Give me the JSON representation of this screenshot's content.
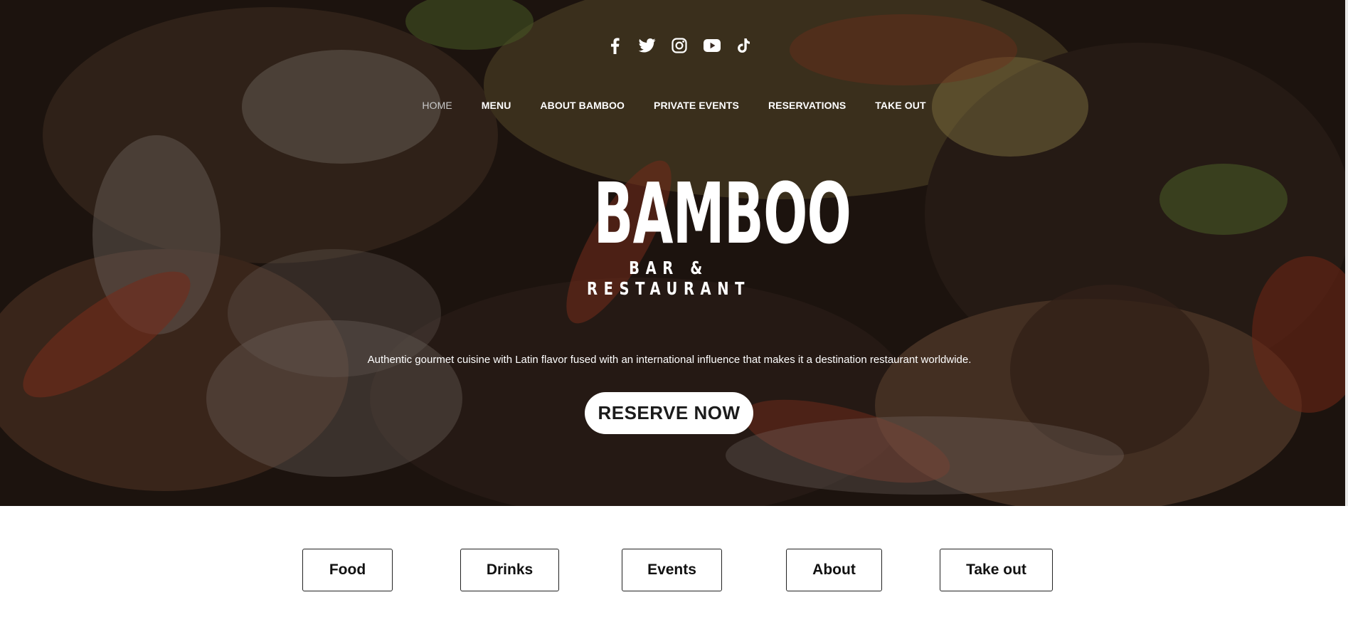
{
  "social": [
    {
      "icon": "facebook-icon"
    },
    {
      "icon": "twitter-icon"
    },
    {
      "icon": "instagram-icon"
    },
    {
      "icon": "youtube-icon"
    },
    {
      "icon": "tiktok-icon"
    }
  ],
  "nav": {
    "items": [
      {
        "label": "HOME",
        "current": true
      },
      {
        "label": "MENU"
      },
      {
        "label": "ABOUT BAMBOO"
      },
      {
        "label": "PRIVATE EVENTS"
      },
      {
        "label": "RESERVATIONS"
      },
      {
        "label": "TAKE OUT"
      }
    ]
  },
  "hero": {
    "logo_title": "BAMBOO",
    "logo_subtitle": "BAR & RESTAURANT",
    "tagline": "Authentic gourmet cuisine with Latin flavor fused with an international influence that makes it a destination restaurant worldwide.",
    "cta_label": "RESERVE NOW"
  },
  "categories": [
    {
      "label": "Food"
    },
    {
      "label": "Drinks"
    },
    {
      "label": "Events"
    },
    {
      "label": "About"
    },
    {
      "label": "Take out"
    }
  ],
  "colors": {
    "hero_overlay": "#000000",
    "text_on_hero": "#ffffff",
    "nav_current": "#c9c9c9",
    "button_bg": "#ffffff",
    "button_border": "#222222"
  }
}
